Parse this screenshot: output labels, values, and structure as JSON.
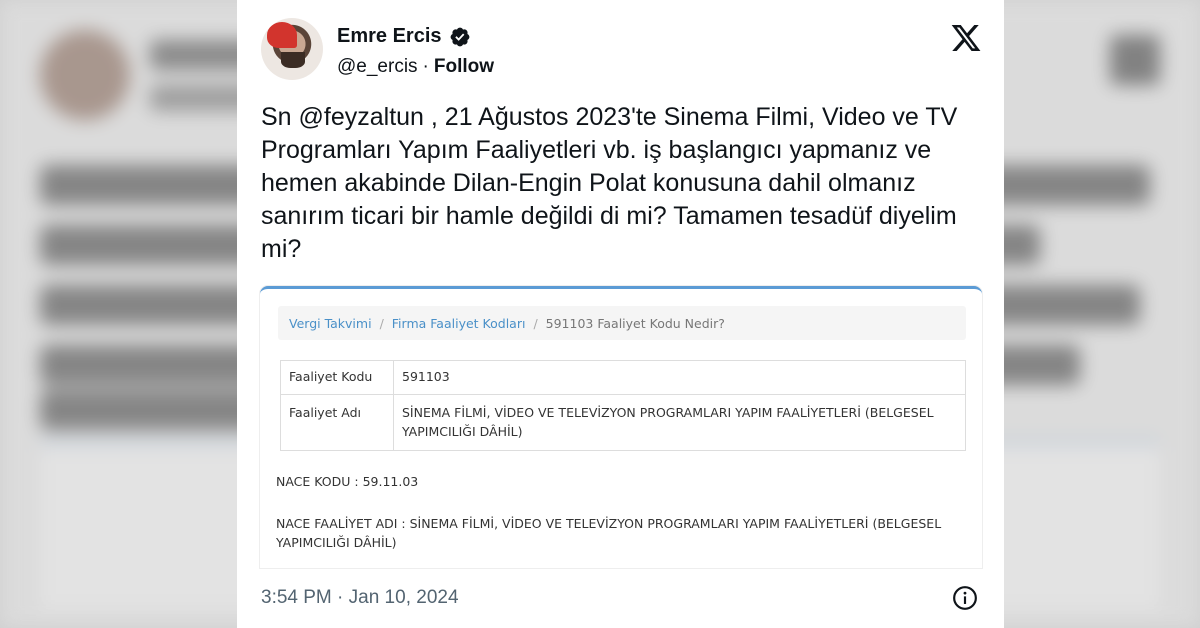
{
  "tweet": {
    "author_name": "Emre Ercis",
    "handle": "@e_ercis",
    "separator": "·",
    "follow_label": "Follow",
    "text": "Sn @feyzaltun , 21 Ağustos 2023'te Sinema Filmi, Video ve TV Programları Yapım Faaliyetleri vb. iş başlangıcı yapmanız ve hemen akabinde Dilan-Engin Polat konusuna dahil olmanız sanırım ticari bir hamle değildi di mi? Tamamen tesadüf diyelim mi?",
    "timestamp": "3:54 PM · Jan 10, 2024"
  },
  "icons": {
    "verified": "verified-badge-icon",
    "x_logo": "x-logo-icon",
    "info": "info-icon"
  },
  "embedded": {
    "breadcrumb": [
      "Vergi Takvimi",
      "Firma Faaliyet Kodları",
      "591103 Faaliyet Kodu Nedir?"
    ],
    "breadcrumb_separator": "/",
    "table": [
      {
        "key": "Faaliyet Kodu",
        "value": "591103"
      },
      {
        "key": "Faaliyet Adı",
        "value": "SİNEMA FİLMİ, VİDEO VE TELEVİZYON PROGRAMLARI YAPIM FAALİYETLERİ (BELGESEL YAPIMCILIĞI DÂHİL)"
      }
    ],
    "nace_code": "NACE KODU : 59.11.03",
    "nace_name": "NACE FAALİYET ADI : SİNEMA FİLMİ, VİDEO VE TELEVİZYON PROGRAMLARI YAPIM FAALİYETLERİ (BELGESEL YAPIMCILIĞI DÂHİL)"
  },
  "colors": {
    "text": "#0f1419",
    "muted": "#536471",
    "verified": "#0f1419",
    "link": "#4a90c8",
    "accent_border": "#5b9bd5"
  }
}
